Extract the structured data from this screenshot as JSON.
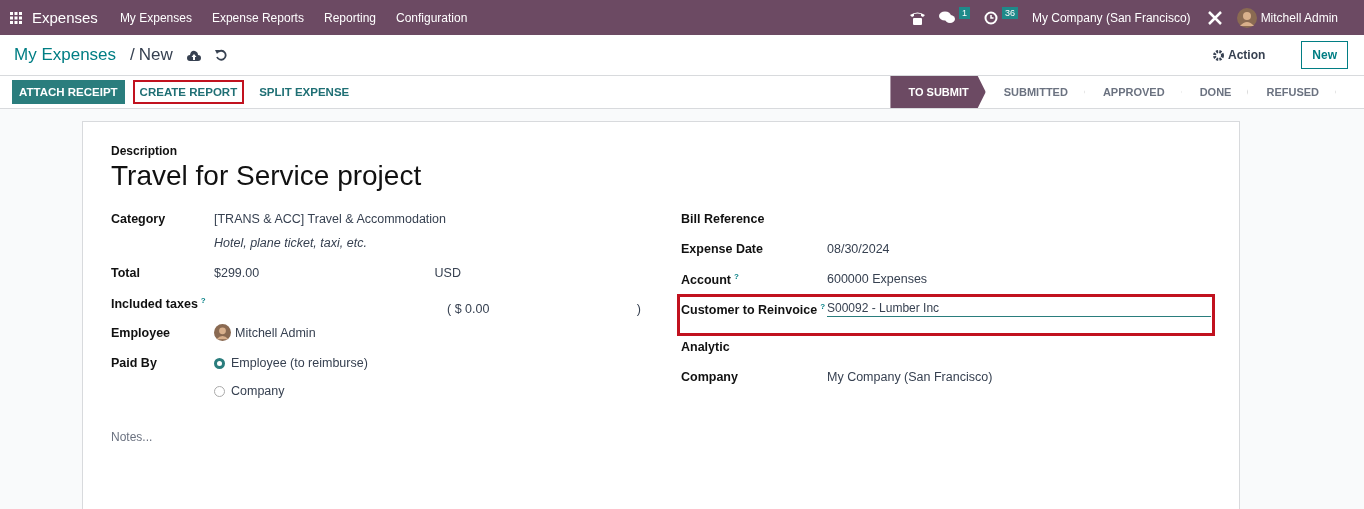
{
  "navbar": {
    "app_name": "Expenses",
    "menu": [
      "My Expenses",
      "Expense Reports",
      "Reporting",
      "Configuration"
    ],
    "chat_badge": "1",
    "activity_badge": "36",
    "company": "My Company (San Francisco)",
    "user": "Mitchell Admin"
  },
  "breadcrumb": {
    "parent": "My Expenses",
    "separator": "/",
    "current": "New"
  },
  "action_label": "Action",
  "new_label": "New",
  "buttons": [
    {
      "label": "ATTACH RECEIPT",
      "primary": true,
      "highlighted": false
    },
    {
      "label": "CREATE REPORT",
      "primary": false,
      "highlighted": true
    },
    {
      "label": "SPLIT EXPENSE",
      "primary": false,
      "highlighted": false
    }
  ],
  "stages": [
    {
      "label": "TO SUBMIT",
      "selected": true
    },
    {
      "label": "SUBMITTED",
      "selected": false
    },
    {
      "label": "APPROVED",
      "selected": false
    },
    {
      "label": "DONE",
      "selected": false
    },
    {
      "label": "REFUSED",
      "selected": false
    }
  ],
  "form": {
    "description_label": "Description",
    "title": "Travel for Service project",
    "left": [
      {
        "kind": "text",
        "label": "Category",
        "value": "[TRANS & ACC] Travel & Accommodation",
        "hint": "Hotel, plane ticket, taxi, etc."
      },
      {
        "kind": "amount",
        "label": "Total",
        "value": "$299.00",
        "currency": "USD"
      },
      {
        "kind": "taxes",
        "label": "Included taxes",
        "help": "?",
        "value": "( $ 0.00",
        "close": ")"
      },
      {
        "kind": "person",
        "label": "Employee",
        "value": "Mitchell Admin"
      },
      {
        "kind": "radio",
        "label": "Paid By",
        "options": [
          {
            "label": "Employee (to reimburse)",
            "selected": true
          },
          {
            "label": "Company",
            "selected": false
          }
        ]
      }
    ],
    "right": [
      {
        "kind": "text",
        "label": "Bill Reference",
        "highlighted": false
      },
      {
        "kind": "text",
        "label": "Expense Date",
        "value": "08/30/2024",
        "highlighted": false
      },
      {
        "kind": "text",
        "label": "Account",
        "help": "?",
        "value": "600000 Expenses",
        "highlighted": false
      },
      {
        "kind": "input",
        "label": "Customer to Reinvoice",
        "help": "?",
        "value": "S00092 - Lumber Inc",
        "highlighted": true
      },
      {
        "kind": "text",
        "label": "Analytic",
        "highlighted": false
      },
      {
        "kind": "text",
        "label": "Company",
        "value": "My Company (San Francisco)",
        "highlighted": false
      }
    ],
    "notes_placeholder": "Notes..."
  }
}
